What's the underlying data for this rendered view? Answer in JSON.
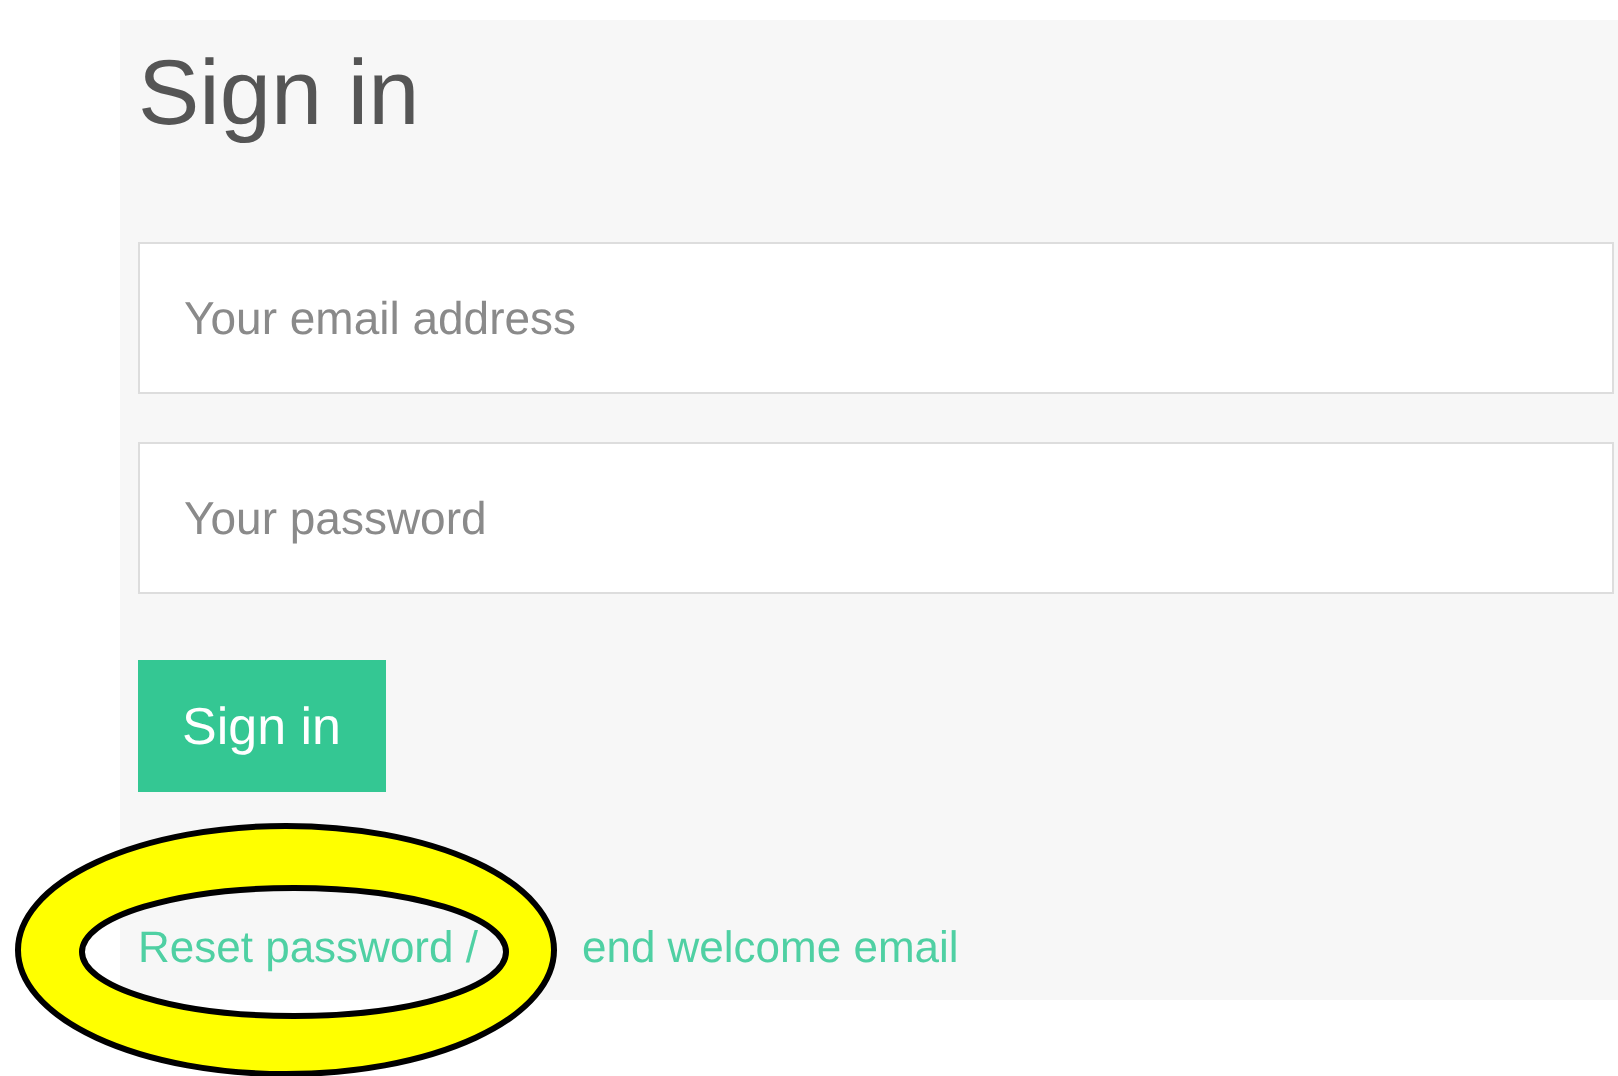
{
  "title": "Sign in",
  "fields": [
    {
      "placeholder": "Your email address"
    },
    {
      "placeholder": "Your password"
    }
  ],
  "submit_button": "Sign in",
  "links": [
    "Reset password /",
    "end welcome email"
  ],
  "annotations": [
    {
      "kind": "ellipse"
    }
  ]
}
